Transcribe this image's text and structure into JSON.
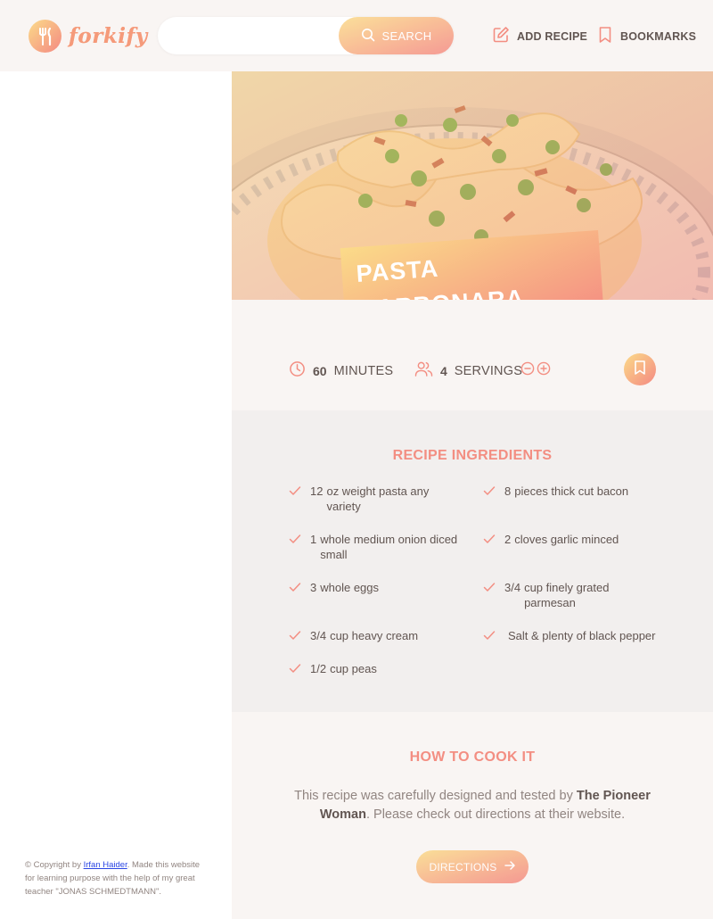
{
  "header": {
    "logo_text": "forkify",
    "search": {
      "value": "",
      "placeholder": "",
      "button_label": "SEARCH"
    },
    "nav": {
      "add_recipe": "ADD RECIPE",
      "bookmarks": "BOOKMARKS"
    }
  },
  "sidebar": {
    "copyright": {
      "prefix": "© Copyright by ",
      "author": "Irfan Haider",
      "suffix": ". Made this website for learning purpose with the help of my great teacher \"JONAS SCHMEDTMANN\"."
    }
  },
  "recipe": {
    "title": "PASTA CARBONARA",
    "cooking_time": "60",
    "time_label": "MINUTES",
    "servings": "4",
    "servings_label": "SERVINGS",
    "ingredients_heading": "RECIPE INGREDIENTS",
    "ingredients": [
      {
        "qty": "12",
        "desc": "oz weight pasta any variety"
      },
      {
        "qty": "8",
        "desc": "pieces thick cut bacon"
      },
      {
        "qty": "1",
        "desc": "whole medium onion diced small"
      },
      {
        "qty": "2",
        "desc": "cloves garlic minced"
      },
      {
        "qty": "3",
        "desc": "whole eggs"
      },
      {
        "qty": "3/4",
        "desc": "cup finely grated parmesan"
      },
      {
        "qty": "3/4",
        "desc": "cup heavy cream"
      },
      {
        "qty": "",
        "desc": "Salt & plenty of black pepper"
      },
      {
        "qty": "1/2",
        "desc": "cup peas"
      }
    ],
    "directions_heading": "HOW TO COOK IT",
    "directions_text_prefix": "This recipe was carefully designed and tested by ",
    "publisher": "The Pioneer Woman",
    "directions_text_suffix": ". Please check out directions at their website.",
    "directions_button": "DIRECTIONS"
  },
  "colors": {
    "accent_start": "#fbdb89",
    "accent_end": "#f48982",
    "heading": "#f38e82",
    "text": "#615551",
    "muted": "#918581"
  },
  "icons": [
    "search-icon",
    "edit-icon",
    "bookmark-icon",
    "clock-icon",
    "users-icon",
    "minus-circle-icon",
    "plus-circle-icon",
    "check-icon",
    "arrow-right-icon"
  ]
}
